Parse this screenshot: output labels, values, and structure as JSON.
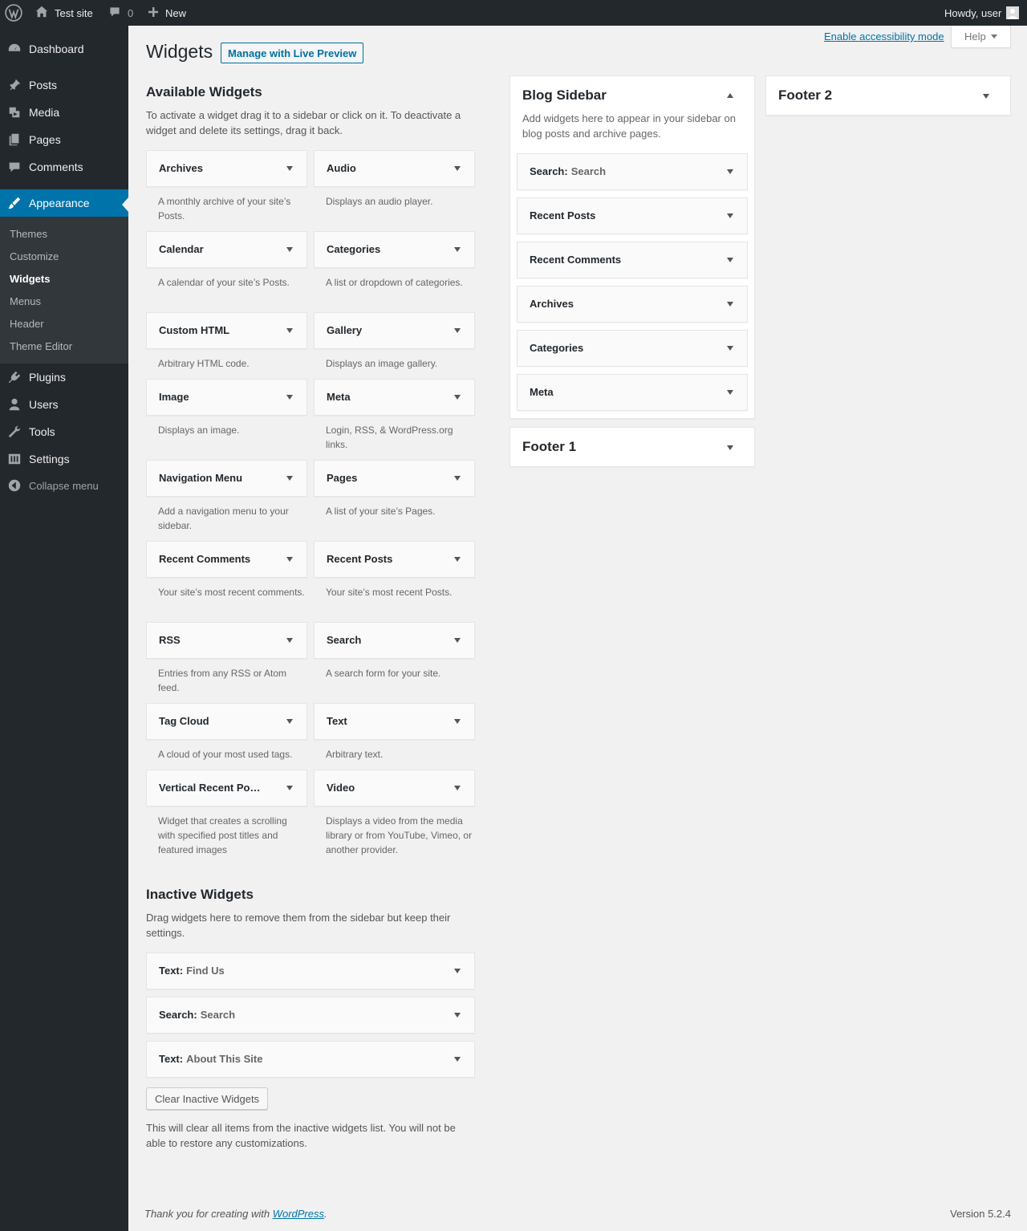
{
  "adminbar": {
    "site_name": "Test site",
    "comments_count": "0",
    "new_label": "New",
    "howdy": "Howdy, user"
  },
  "menu": {
    "dashboard": "Dashboard",
    "posts": "Posts",
    "media": "Media",
    "pages": "Pages",
    "comments": "Comments",
    "appearance": "Appearance",
    "submenu": [
      "Themes",
      "Customize",
      "Widgets",
      "Menus",
      "Header",
      "Theme Editor"
    ],
    "plugins": "Plugins",
    "users": "Users",
    "tools": "Tools",
    "settings": "Settings",
    "collapse": "Collapse menu"
  },
  "page": {
    "title": "Widgets",
    "live_preview": "Manage with Live Preview",
    "accessibility_link": "Enable accessibility mode",
    "help": "Help"
  },
  "available": {
    "heading": "Available Widgets",
    "description": "To activate a widget drag it to a sidebar or click on it. To deactivate a widget and delete its settings, drag it back.",
    "widgets": [
      {
        "title": "Archives",
        "desc": "A monthly archive of your site’s Posts."
      },
      {
        "title": "Audio",
        "desc": "Displays an audio player."
      },
      {
        "title": "Calendar",
        "desc": "A calendar of your site’s Posts."
      },
      {
        "title": "Categories",
        "desc": "A list or dropdown of categories."
      },
      {
        "title": "Custom HTML",
        "desc": "Arbitrary HTML code."
      },
      {
        "title": "Gallery",
        "desc": "Displays an image gallery."
      },
      {
        "title": "Image",
        "desc": "Displays an image."
      },
      {
        "title": "Meta",
        "desc": "Login, RSS, & WordPress.org links."
      },
      {
        "title": "Navigation Menu",
        "desc": "Add a navigation menu to your sidebar."
      },
      {
        "title": "Pages",
        "desc": "A list of your site’s Pages."
      },
      {
        "title": "Recent Comments",
        "desc": "Your site’s most recent comments."
      },
      {
        "title": "Recent Posts",
        "desc": "Your site’s most recent Posts."
      },
      {
        "title": "RSS",
        "desc": "Entries from any RSS or Atom feed."
      },
      {
        "title": "Search",
        "desc": "A search form for your site."
      },
      {
        "title": "Tag Cloud",
        "desc": "A cloud of your most used tags."
      },
      {
        "title": "Text",
        "desc": "Arbitrary text."
      },
      {
        "title": "Vertical Recent Po…",
        "desc": "Widget that creates a scrolling with specified post titles and featured images"
      },
      {
        "title": "Video",
        "desc": "Displays a video from the media library or from YouTube, Vimeo, or another provider."
      }
    ]
  },
  "blog_sidebar": {
    "title": "Blog Sidebar",
    "description": "Add widgets here to appear in your sidebar on blog posts and archive pages.",
    "widgets": [
      {
        "title": "Search:",
        "sub": "Search"
      },
      {
        "title": "Recent Posts",
        "sub": ""
      },
      {
        "title": "Recent Comments",
        "sub": ""
      },
      {
        "title": "Archives",
        "sub": ""
      },
      {
        "title": "Categories",
        "sub": ""
      },
      {
        "title": "Meta",
        "sub": ""
      }
    ]
  },
  "footer1": {
    "title": "Footer 1"
  },
  "footer2": {
    "title": "Footer 2"
  },
  "inactive": {
    "heading": "Inactive Widgets",
    "description": "Drag widgets here to remove them from the sidebar but keep their settings.",
    "widgets": [
      {
        "title": "Text:",
        "sub": "Find Us"
      },
      {
        "title": "Search:",
        "sub": "Search"
      },
      {
        "title": "Text:",
        "sub": "About This Site"
      }
    ],
    "clear_button": "Clear Inactive Widgets",
    "clear_note": "This will clear all items from the inactive widgets list. You will not be able to restore any customizations."
  },
  "footer": {
    "thanks_prefix": "Thank you for creating with",
    "wordpress": "WordPress",
    "thanks_suffix": ".",
    "version": "Version 5.2.4"
  },
  "colors": {
    "accent": "#0073aa",
    "adminbar": "#23282d",
    "background": "#f1f1f1"
  }
}
